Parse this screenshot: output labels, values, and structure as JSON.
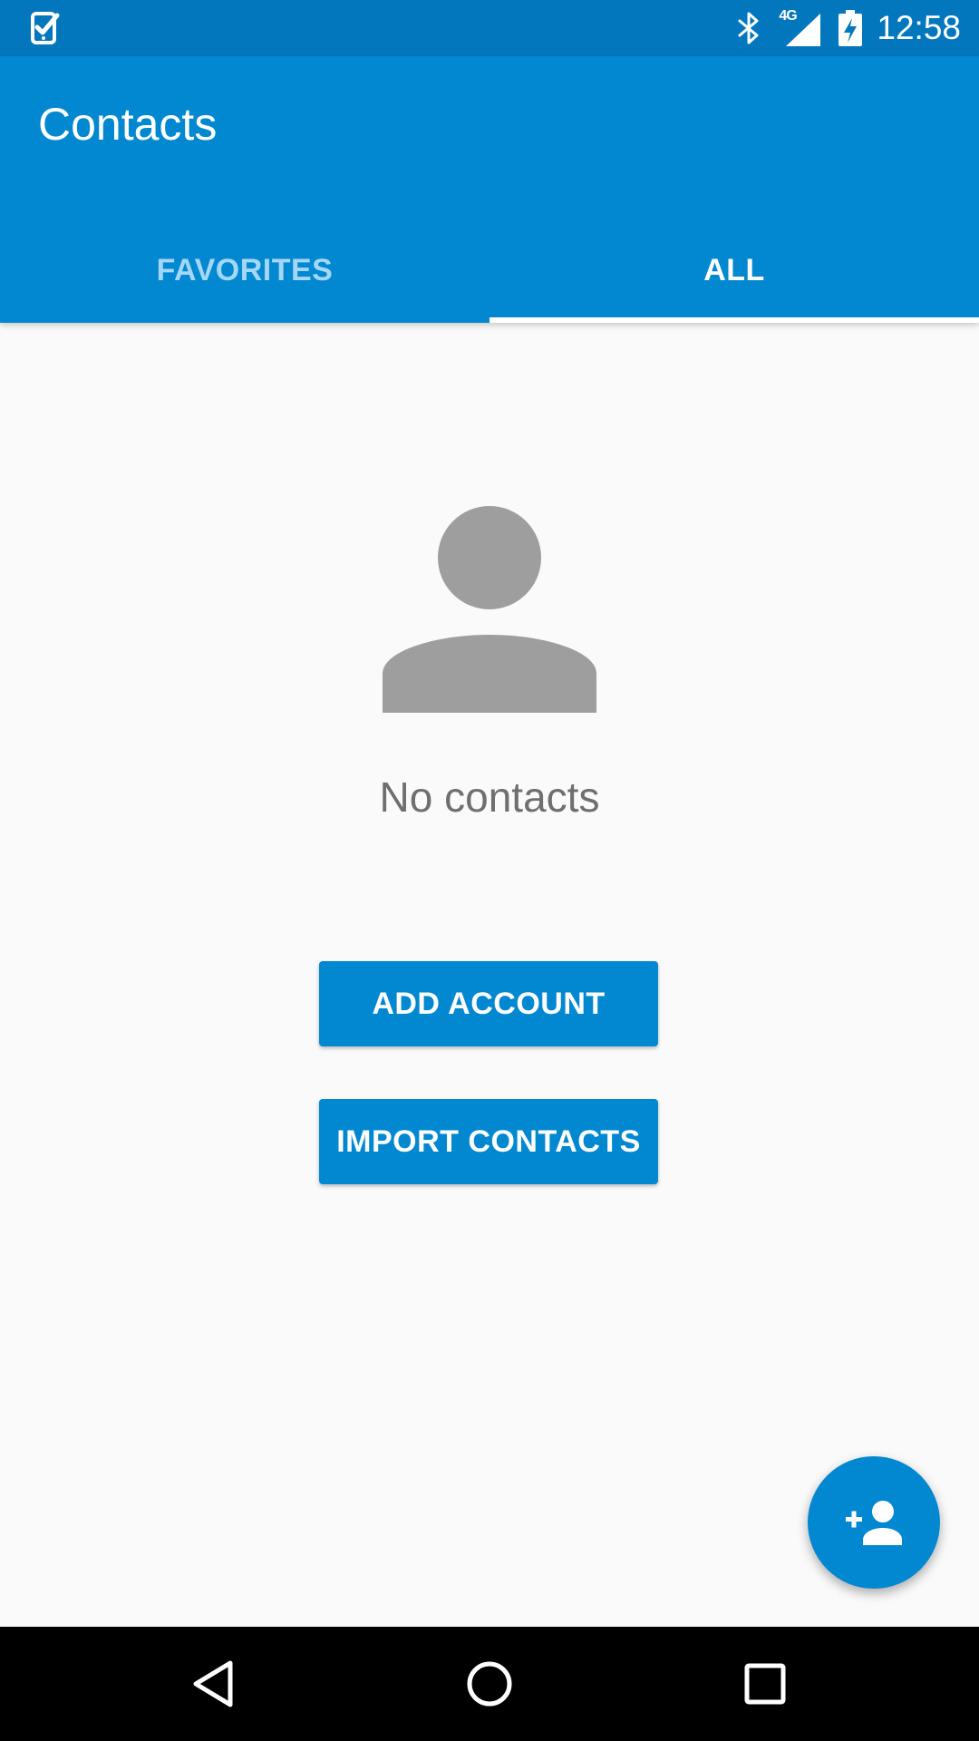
{
  "status_bar": {
    "notification_icon": "task-check-icon",
    "bluetooth_icon": "bluetooth-icon",
    "network_type": "4G",
    "signal_icon": "cell-signal-icon",
    "battery_icon": "battery-charging-icon",
    "time": "12:58"
  },
  "app_bar": {
    "title": "Contacts",
    "tabs": [
      {
        "label": "FAVORITES",
        "selected": false
      },
      {
        "label": "ALL",
        "selected": true
      }
    ]
  },
  "empty_state": {
    "icon": "person-icon",
    "message": "No contacts"
  },
  "actions": {
    "add_account": "ADD ACCOUNT",
    "import_contacts": "IMPORT CONTACTS"
  },
  "fab": {
    "icon": "add-person-icon"
  },
  "nav_bar": {
    "back_icon": "back-triangle-icon",
    "home_icon": "home-circle-icon",
    "recents_icon": "recents-square-icon"
  },
  "colors": {
    "status_bar": "#0277bd",
    "primary": "#0288d1",
    "background": "#fafafa",
    "inactive_tab": "#a3d7f5",
    "empty_icon": "#9e9e9e",
    "empty_text": "#6f6f6f"
  }
}
